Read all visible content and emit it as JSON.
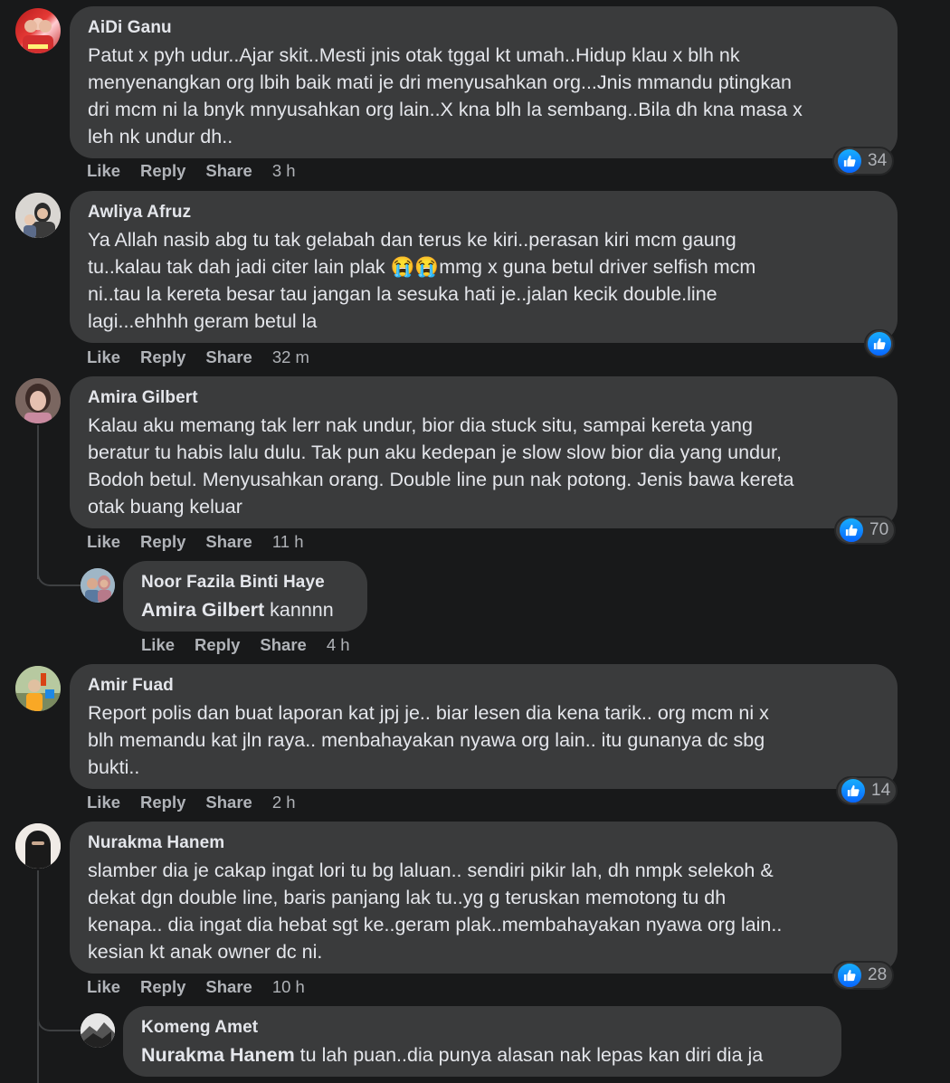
{
  "comments": [
    {
      "author": "AiDi Ganu",
      "text": "Patut x pyh udur..Ajar skit..Mesti jnis otak tggal kt umah..Hidup klau x blh nk\nmenyenangkan org lbih baik mati je dri menyusahkan org...Jnis mmandu ptingkan\ndri mcm ni la bnyk mnyusahkan org lain..X kna blh la sembang..Bila dh kna masa x\nleh nk undur dh..",
      "like": "Like",
      "reply": "Reply",
      "share": "Share",
      "time": "3 h",
      "reactions": "34"
    },
    {
      "author": "Awliya Afruz",
      "text_before": "Ya Allah nasib abg tu tak gelabah dan terus ke kiri..perasan kiri mcm gaung\ntu..kalau tak dah jadi citer lain plak ",
      "emoji": "😭😭",
      "text_after": "mmg x guna betul driver selfish mcm\nni..tau la kereta besar tau jangan la sesuka hati je..jalan kecik double.line\nlagi...ehhhh geram betul la",
      "like": "Like",
      "reply": "Reply",
      "share": "Share",
      "time": "32 m"
    },
    {
      "author": "Amira Gilbert",
      "text": "Kalau aku memang tak lerr nak undur, bior dia stuck situ, sampai kereta yang\nberatur tu habis lalu dulu. Tak pun aku kedepan je slow slow bior dia yang undur,\nBodoh betul. Menyusahkan orang. Double line pun nak potong. Jenis bawa kereta\notak buang keluar",
      "like": "Like",
      "reply": "Reply",
      "share": "Share",
      "time": "11 h",
      "reactions": "70"
    },
    {
      "author": "Noor Fazila Binti Haye",
      "mention": "Amira Gilbert",
      "text": " kannnn",
      "like": "Like",
      "reply": "Reply",
      "share": "Share",
      "time": "4 h"
    },
    {
      "author": "Amir Fuad",
      "text": "Report polis dan buat laporan kat jpj je.. biar lesen dia kena tarik.. org mcm ni x\nblh memandu kat jln raya.. menbahayakan nyawa org lain.. itu gunanya dc sbg\nbukti..",
      "like": "Like",
      "reply": "Reply",
      "share": "Share",
      "time": "2 h",
      "reactions": "14"
    },
    {
      "author": "Nurakma Hanem",
      "text": "slamber dia je cakap ingat lori tu bg laluan.. sendiri pikir lah, dh nmpk selekoh &\ndekat dgn double line, baris panjang lak tu..yg g teruskan memotong tu dh\nkenapa.. dia ingat dia hebat sgt ke..geram plak..membahayakan nyawa org lain..\nkesian kt anak owner dc ni.",
      "like": "Like",
      "reply": "Reply",
      "share": "Share",
      "time": "10 h",
      "reactions": "28"
    },
    {
      "author": "Komeng Amet",
      "mention": "Nurakma Hanem",
      "text": " tu lah puan..dia punya alasan nak lepas kan diri dia ja"
    }
  ],
  "colors": {
    "background": "#18191a",
    "bubble": "#3a3b3c",
    "text": "#e4e6eb",
    "secondary": "#b0b3b8",
    "like_blue": "#0866ff"
  },
  "icons": {
    "like": "thumbs-up-icon"
  }
}
